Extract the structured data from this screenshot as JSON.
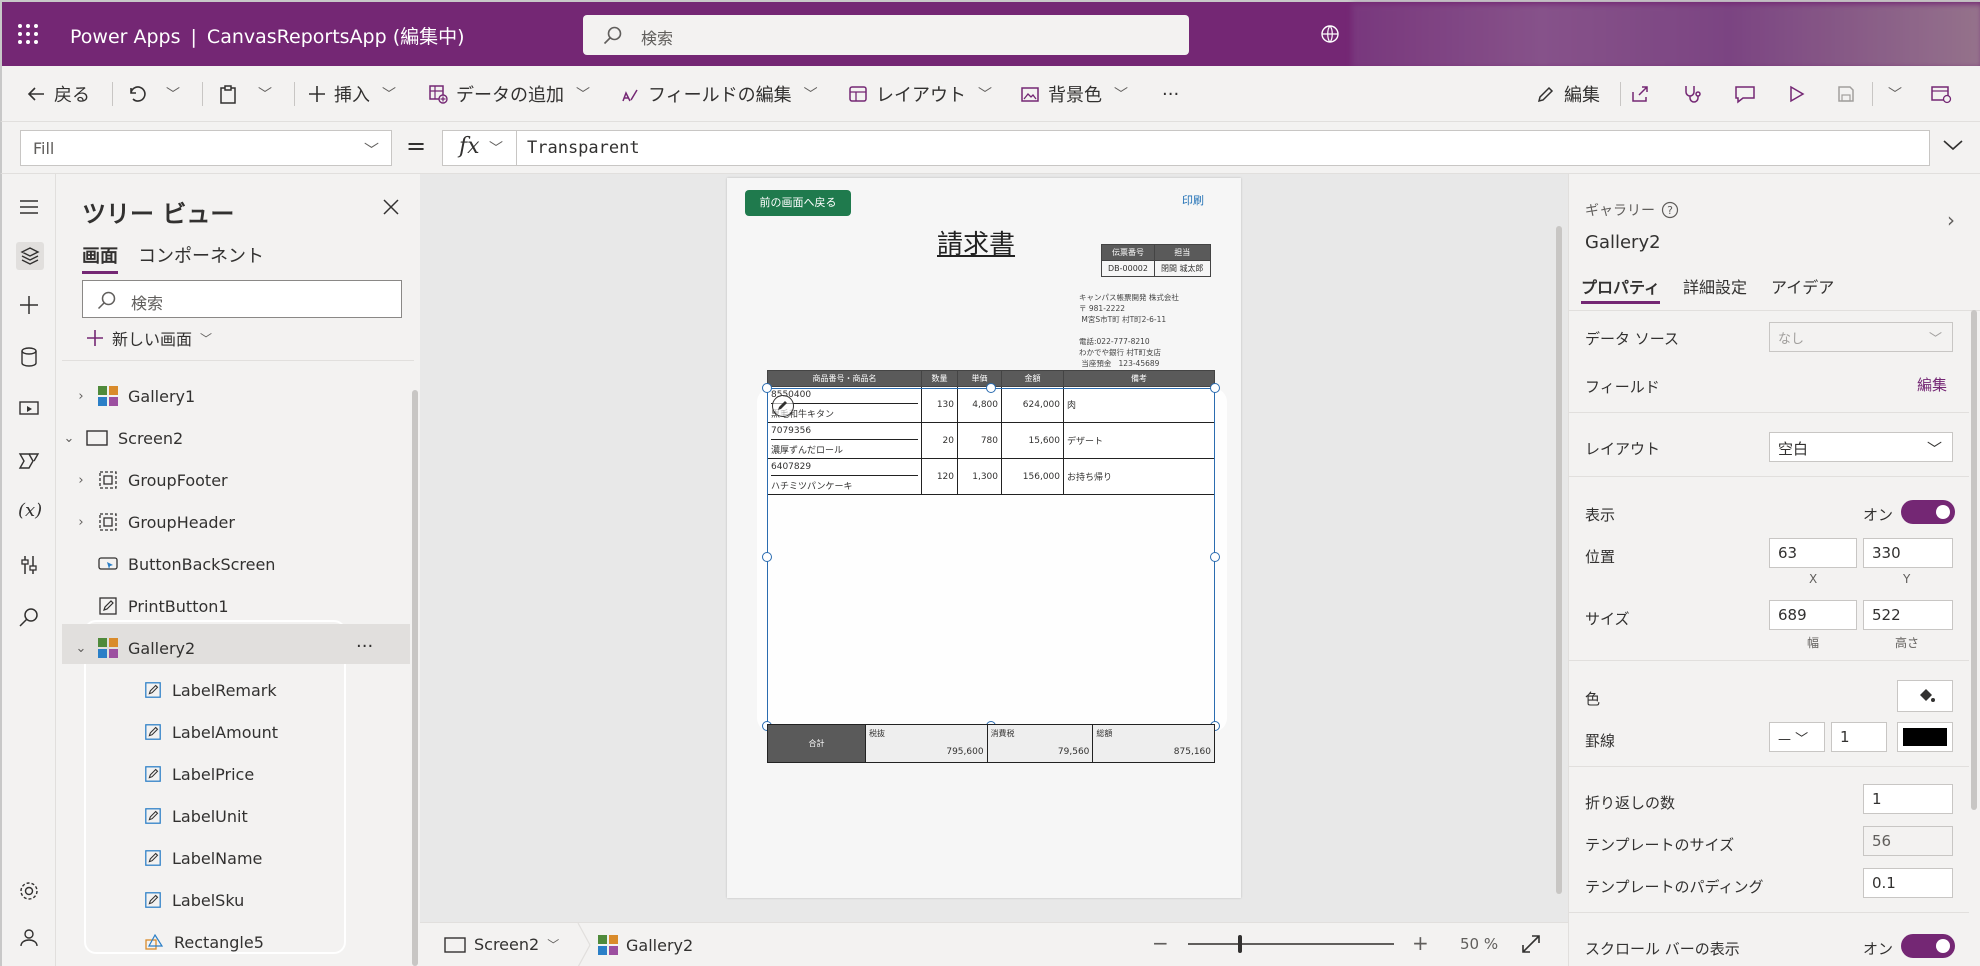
{
  "app": {
    "title": "Power Apps",
    "separator": "|",
    "app_name": "CanvasReportsApp (編集中)",
    "search_placeholder": "検索"
  },
  "toolbar": {
    "back": "戻る",
    "insert": "挿入",
    "add_data": "データの追加",
    "edit_fields": "フィールドの編集",
    "layout": "レイアウト",
    "background_color": "背景色",
    "more": "···",
    "edit": "編集"
  },
  "formula_bar": {
    "property": "Fill",
    "equals": "=",
    "fx": "fx",
    "formula": "Transparent"
  },
  "tree": {
    "title": "ツリー ビュー",
    "tabs": [
      "画面",
      "コンポーネント"
    ],
    "search_placeholder": "検索",
    "new_screen": "新しい画面",
    "items": [
      {
        "label": "Gallery1"
      },
      {
        "label": "Screen2"
      },
      {
        "label": "GroupFooter"
      },
      {
        "label": "GroupHeader"
      },
      {
        "label": "ButtonBackScreen"
      },
      {
        "label": "PrintButton1"
      },
      {
        "label": "Gallery2"
      },
      {
        "label": "LabelRemark"
      },
      {
        "label": "LabelAmount"
      },
      {
        "label": "LabelPrice"
      },
      {
        "label": "LabelUnit"
      },
      {
        "label": "LabelName"
      },
      {
        "label": "LabelSku"
      },
      {
        "label": "Rectangle5"
      }
    ],
    "more": "···"
  },
  "document": {
    "back_button": "前の画面へ戻る",
    "print": "印刷",
    "title": "請求書",
    "meta_headers": [
      "伝票番号",
      "担当"
    ],
    "meta_values": [
      "DB-00002",
      "閉間 城太郎"
    ],
    "address": "キャンパス帳票開発 株式会社\n〒 981-2222\n M宮S市T町 村T町2-6-11\n\n電話:022-777-8210\nわかでや銀行 村T町支店\n 当座預金   123-45689",
    "table_headers": [
      "商品番号・商品名",
      "数量",
      "単価",
      "金額",
      "備考"
    ],
    "rows": [
      {
        "sku": "8550400",
        "name": "黒毛和牛キタン",
        "qty": "130",
        "price": "4,800",
        "amount": "624,000",
        "remark": "肉"
      },
      {
        "sku": "7079356",
        "name": "濃厚ずんだロール",
        "qty": "20",
        "price": "780",
        "amount": "15,600",
        "remark": "デザート"
      },
      {
        "sku": "6407829",
        "name": "ハチミツパンケーキ",
        "qty": "120",
        "price": "1,300",
        "amount": "156,000",
        "remark": "お持ち帰り"
      }
    ],
    "total_label": "合計",
    "totals": [
      {
        "label": "税抜",
        "value": "795,600"
      },
      {
        "label": "消費税",
        "value": "79,560"
      },
      {
        "label": "総額",
        "value": "875,160"
      }
    ]
  },
  "bottom_bar": {
    "screen": "Screen2",
    "control": "Gallery2",
    "zoom_minus": "−",
    "zoom_plus": "+",
    "zoom_value": "50",
    "zoom_unit": "%"
  },
  "properties": {
    "control_type": "ギャラリー",
    "control_name": "Gallery2",
    "tabs": [
      "プロパティ",
      "詳細設定",
      "アイデア"
    ],
    "data_source_label": "データ ソース",
    "data_source_value": "なし",
    "fields_label": "フィールド",
    "fields_edit": "編集",
    "layout_label": "レイアウト",
    "layout_value": "空白",
    "visible_label": "表示",
    "on": "オン",
    "position_label": "位置",
    "position_x": "63",
    "position_y": "330",
    "x_label": "X",
    "y_label": "Y",
    "size_label": "サイズ",
    "width": "689",
    "height": "522",
    "width_label": "幅",
    "height_label": "高さ",
    "color_label": "色",
    "border_label": "罫線",
    "border_width": "1",
    "wrap_count_label": "折り返しの数",
    "wrap_count": "1",
    "template_size_label": "テンプレートのサイズ",
    "template_size": "56",
    "template_padding_label": "テンプレートのパディング",
    "template_padding": "0.1",
    "scrollbar_label": "スクロール バーの表示"
  },
  "colors": {
    "brand": "#742774",
    "accent_blue": "#2b6cb0",
    "doc_button": "#1f7a4d"
  }
}
